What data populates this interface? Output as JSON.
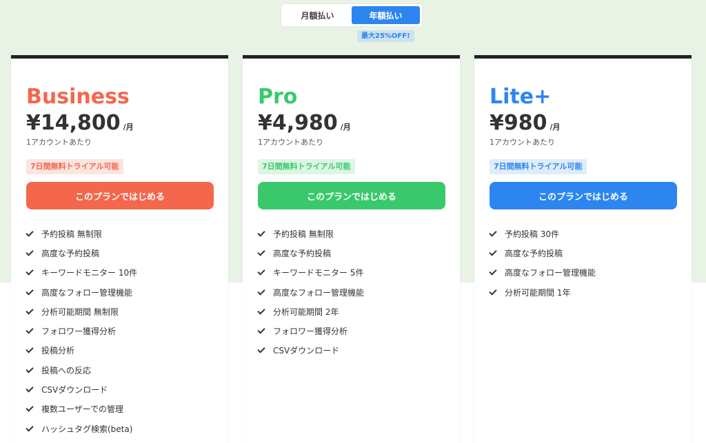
{
  "billing_toggle": {
    "monthly_label": "月額払い",
    "yearly_label": "年額払い",
    "discount_badge": "最大25%OFF!"
  },
  "colors": {
    "business": "#f4674d",
    "pro": "#39c96c",
    "lite": "#2d86f0",
    "business_badge_bg": "#fde5df",
    "pro_badge_bg": "#dcf6e3",
    "lite_badge_bg": "#deecfb"
  },
  "plans": [
    {
      "name": "Business",
      "price": "¥14,800",
      "price_unit": "/月",
      "price_note": "1アカウントあたり",
      "trial_badge": "7日間無料トライアル可能",
      "cta_label": "このプランではじめる",
      "features": [
        "予約投稿 無制限",
        "高度な予約投稿",
        "キーワードモニター 10件",
        "高度なフォロー管理機能",
        "分析可能期間 無制限",
        "フォロワー獲得分析",
        "投稿分析",
        "投稿への反応",
        "CSVダウンロード",
        "複数ユーザーでの管理",
        "ハッシュタグ検索(beta)"
      ]
    },
    {
      "name": "Pro",
      "price": "¥4,980",
      "price_unit": "/月",
      "price_note": "1アカウントあたり",
      "trial_badge": "7日間無料トライアル可能",
      "cta_label": "このプランではじめる",
      "features": [
        "予約投稿 無制限",
        "高度な予約投稿",
        "キーワードモニター 5件",
        "高度なフォロー管理機能",
        "分析可能期間 2年",
        "フォロワー獲得分析",
        "CSVダウンロード"
      ]
    },
    {
      "name": "Lite+",
      "price": "¥980",
      "price_unit": "/月",
      "price_note": "1アカウントあたり",
      "trial_badge": "7日間無料トライアル可能",
      "cta_label": "このプランではじめる",
      "features": [
        "予約投稿 30件",
        "高度な予約投稿",
        "高度なフォロー管理機能",
        "分析可能期間 1年"
      ]
    }
  ]
}
